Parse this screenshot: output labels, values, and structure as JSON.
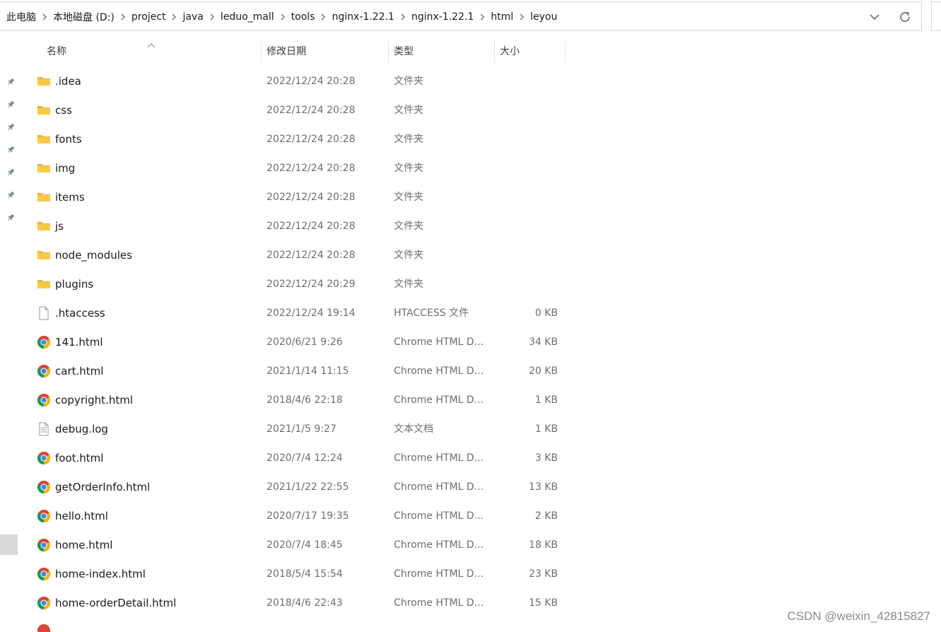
{
  "breadcrumb": [
    "此电脑",
    "本地磁盘 (D:)",
    "project",
    "java",
    "leduo_mall",
    "tools",
    "nginx-1.22.1",
    "nginx-1.22.1",
    "html",
    "leyou"
  ],
  "columns": {
    "name": "名称",
    "date": "修改日期",
    "type": "类型",
    "size": "大小"
  },
  "sort": {
    "column": "name",
    "direction": "ascending"
  },
  "icons": {
    "folder": "folder-icon",
    "file": "file-icon",
    "chrome": "chrome-icon",
    "text": "text-document-icon",
    "pin": "pin-icon"
  },
  "files": [
    {
      "name": ".idea",
      "date": "2022/12/24 20:28",
      "type": "文件夹",
      "size": "",
      "icon": "folder"
    },
    {
      "name": "css",
      "date": "2022/12/24 20:28",
      "type": "文件夹",
      "size": "",
      "icon": "folder"
    },
    {
      "name": "fonts",
      "date": "2022/12/24 20:28",
      "type": "文件夹",
      "size": "",
      "icon": "folder"
    },
    {
      "name": "img",
      "date": "2022/12/24 20:28",
      "type": "文件夹",
      "size": "",
      "icon": "folder"
    },
    {
      "name": "items",
      "date": "2022/12/24 20:28",
      "type": "文件夹",
      "size": "",
      "icon": "folder"
    },
    {
      "name": "js",
      "date": "2022/12/24 20:28",
      "type": "文件夹",
      "size": "",
      "icon": "folder"
    },
    {
      "name": "node_modules",
      "date": "2022/12/24 20:28",
      "type": "文件夹",
      "size": "",
      "icon": "folder"
    },
    {
      "name": "plugins",
      "date": "2022/12/24 20:29",
      "type": "文件夹",
      "size": "",
      "icon": "folder"
    },
    {
      "name": ".htaccess",
      "date": "2022/12/24 19:14",
      "type": "HTACCESS 文件",
      "size": "0 KB",
      "icon": "file"
    },
    {
      "name": "141.html",
      "date": "2020/6/21 9:26",
      "type": "Chrome HTML D...",
      "size": "34 KB",
      "icon": "chrome"
    },
    {
      "name": "cart.html",
      "date": "2021/1/14 11:15",
      "type": "Chrome HTML D...",
      "size": "20 KB",
      "icon": "chrome"
    },
    {
      "name": "copyright.html",
      "date": "2018/4/6 22:18",
      "type": "Chrome HTML D...",
      "size": "1 KB",
      "icon": "chrome"
    },
    {
      "name": "debug.log",
      "date": "2021/1/5 9:27",
      "type": "文本文档",
      "size": "1 KB",
      "icon": "text"
    },
    {
      "name": "foot.html",
      "date": "2020/7/4 12:24",
      "type": "Chrome HTML D...",
      "size": "3 KB",
      "icon": "chrome"
    },
    {
      "name": "getOrderInfo.html",
      "date": "2021/1/22 22:55",
      "type": "Chrome HTML D...",
      "size": "13 KB",
      "icon": "chrome"
    },
    {
      "name": "hello.html",
      "date": "2020/7/17 19:35",
      "type": "Chrome HTML D...",
      "size": "2 KB",
      "icon": "chrome"
    },
    {
      "name": "home.html",
      "date": "2020/7/4 18:45",
      "type": "Chrome HTML D...",
      "size": "18 KB",
      "icon": "chrome"
    },
    {
      "name": "home-index.html",
      "date": "2018/5/4 15:54",
      "type": "Chrome HTML D...",
      "size": "23 KB",
      "icon": "chrome"
    },
    {
      "name": "home-orderDetail.html",
      "date": "2018/4/6 22:43",
      "type": "Chrome HTML D...",
      "size": "15 KB",
      "icon": "chrome"
    }
  ],
  "watermark": "CSDN @weixin_42815827",
  "colors": {
    "folder": "#f8c943",
    "chrome_red": "#db4437",
    "chrome_green": "#0f9d58",
    "chrome_yellow": "#f4b400",
    "chrome_blue": "#4285f4"
  }
}
